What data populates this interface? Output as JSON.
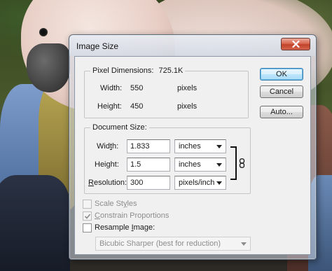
{
  "dialog": {
    "title": "Image Size"
  },
  "pixel_dimensions": {
    "label": "Pixel Dimensions:",
    "value": "725.1K",
    "width_label": "Width:",
    "width_value": "550",
    "width_unit": "pixels",
    "height_label": "Height:",
    "height_value": "450",
    "height_unit": "pixels"
  },
  "document_size": {
    "label": "Document Size:",
    "width_label_pre": "Wid",
    "width_label_u": "t",
    "width_label_post": "h:",
    "width_value": "1.833",
    "width_unit": "inches",
    "height_label_pre": "Hei",
    "height_label_u": "g",
    "height_label_post": "ht:",
    "height_value": "1.5",
    "height_unit": "inches",
    "resolution_label_u": "R",
    "resolution_label_post": "esolution:",
    "resolution_value": "300",
    "resolution_unit": "pixels/inch"
  },
  "buttons": {
    "ok": "OK",
    "cancel": "Cancel",
    "auto": "Auto..."
  },
  "options": {
    "scale_styles_pre": "Scale St",
    "scale_styles_u": "y",
    "scale_styles_post": "les",
    "constrain_proportions_u": "C",
    "constrain_proportions_post": "onstrain Proportions",
    "resample_pre": "Resample ",
    "resample_u": "I",
    "resample_post": "mage:",
    "scale_styles_checked": false,
    "constrain_proportions_checked": true,
    "resample_checked": false
  },
  "resample_method": {
    "selected": "Bicubic Sharper (best for reduction)"
  },
  "icons": {
    "close": "close-icon",
    "link": "chain-link-icon",
    "check": "checkmark-icon",
    "dropdown": "chevron-down-icon"
  },
  "colors": {
    "ok_border": "#3c7fb1",
    "close_button": "#c2412a"
  }
}
